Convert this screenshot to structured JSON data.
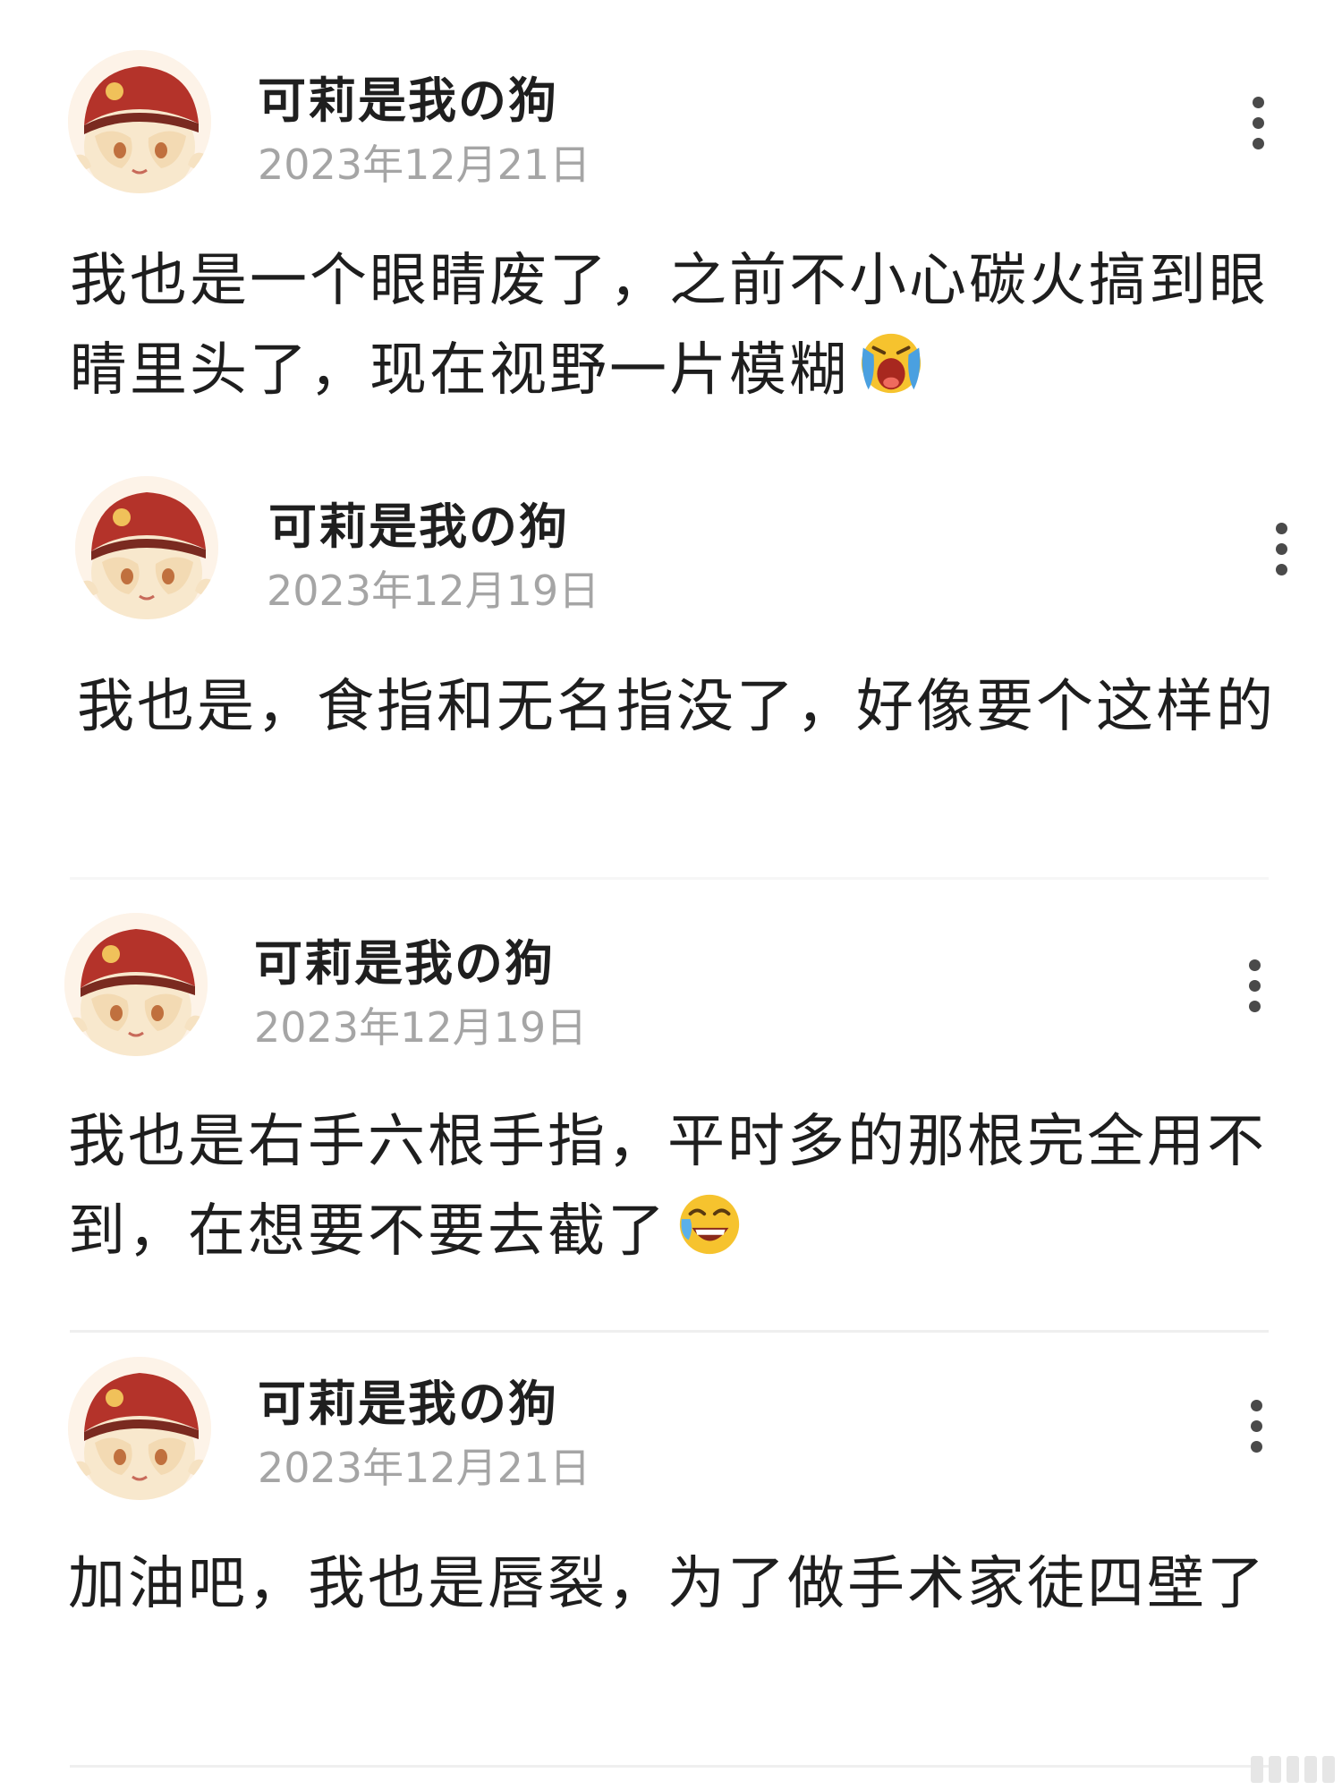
{
  "comments": [
    {
      "username": "可莉是我の狗",
      "date": "2023年12月21日",
      "text": "我也是一个眼睛废了，之前不小心碳火搞到眼睛里头了，现在视野一片模糊",
      "emoji": "crying-face-icon"
    },
    {
      "username": "可莉是我の狗",
      "date": "2023年12月19日",
      "text": "我也是，食指和无名指没了，好像要个这样的",
      "emoji": ""
    },
    {
      "username": "可莉是我の狗",
      "date": "2023年12月19日",
      "text": "我也是右手六根手指，平时多的那根完全用不到，在想要不要去截了",
      "emoji": "laughing-face-icon"
    },
    {
      "username": "可莉是我の狗",
      "date": "2023年12月21日",
      "text": "加油吧，我也是唇裂，为了做手术家徒四壁了",
      "emoji": ""
    }
  ],
  "colors": {
    "username": "#1f1f1f",
    "timestamp": "#a5a5a5",
    "body": "#1e1e1e",
    "divider": "#efefef",
    "avatar_hat": "#b4332a",
    "avatar_hair": "#f7e6c9"
  }
}
